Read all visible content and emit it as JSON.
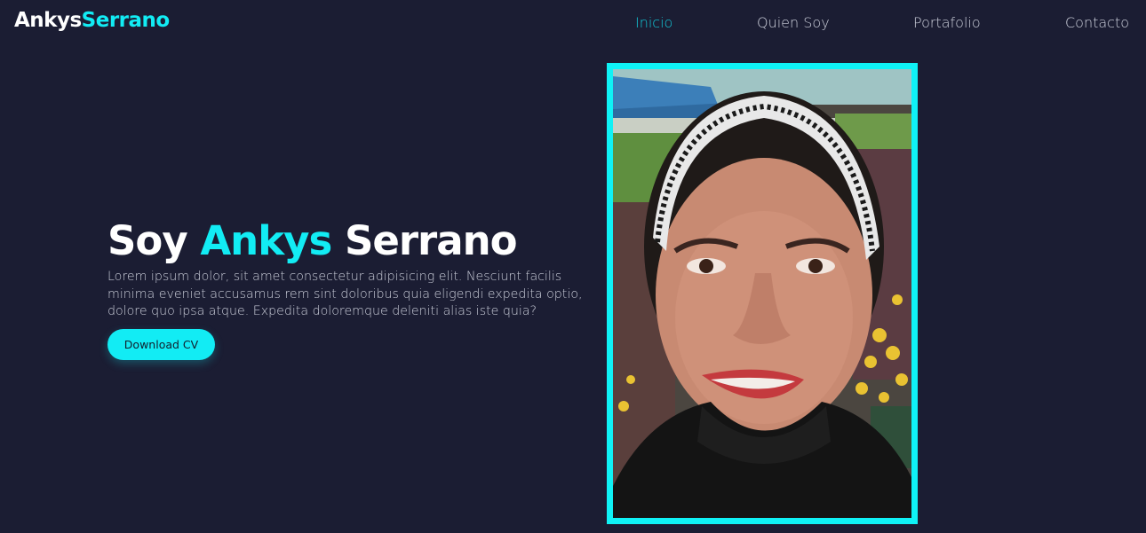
{
  "header": {
    "logo_part1": "Ankys",
    "logo_part2": "Serrano",
    "nav": [
      {
        "label": "Inicio",
        "active": true
      },
      {
        "label": "Quien Soy",
        "active": false
      },
      {
        "label": "Portafolio",
        "active": false
      },
      {
        "label": "Contacto",
        "active": false
      }
    ]
  },
  "hero": {
    "title_prefix": "Soy",
    "title_name": "Ankys",
    "title_surname": "Serrano",
    "description": "Lorem ipsum dolor, sit amet consectetur adipisicing elit. Nesciunt facilis minima eveniet accusamus rem sint doloribus quia eligendi expedita optio, dolore quo ipsa atque. Expedita doloremque deleniti alias iste quia?",
    "cta_label": "Download CV"
  },
  "colors": {
    "background": "#1b1d33",
    "accent": "#12ecf4",
    "nav_active": "#12c9d9",
    "text": "#ffffff"
  }
}
